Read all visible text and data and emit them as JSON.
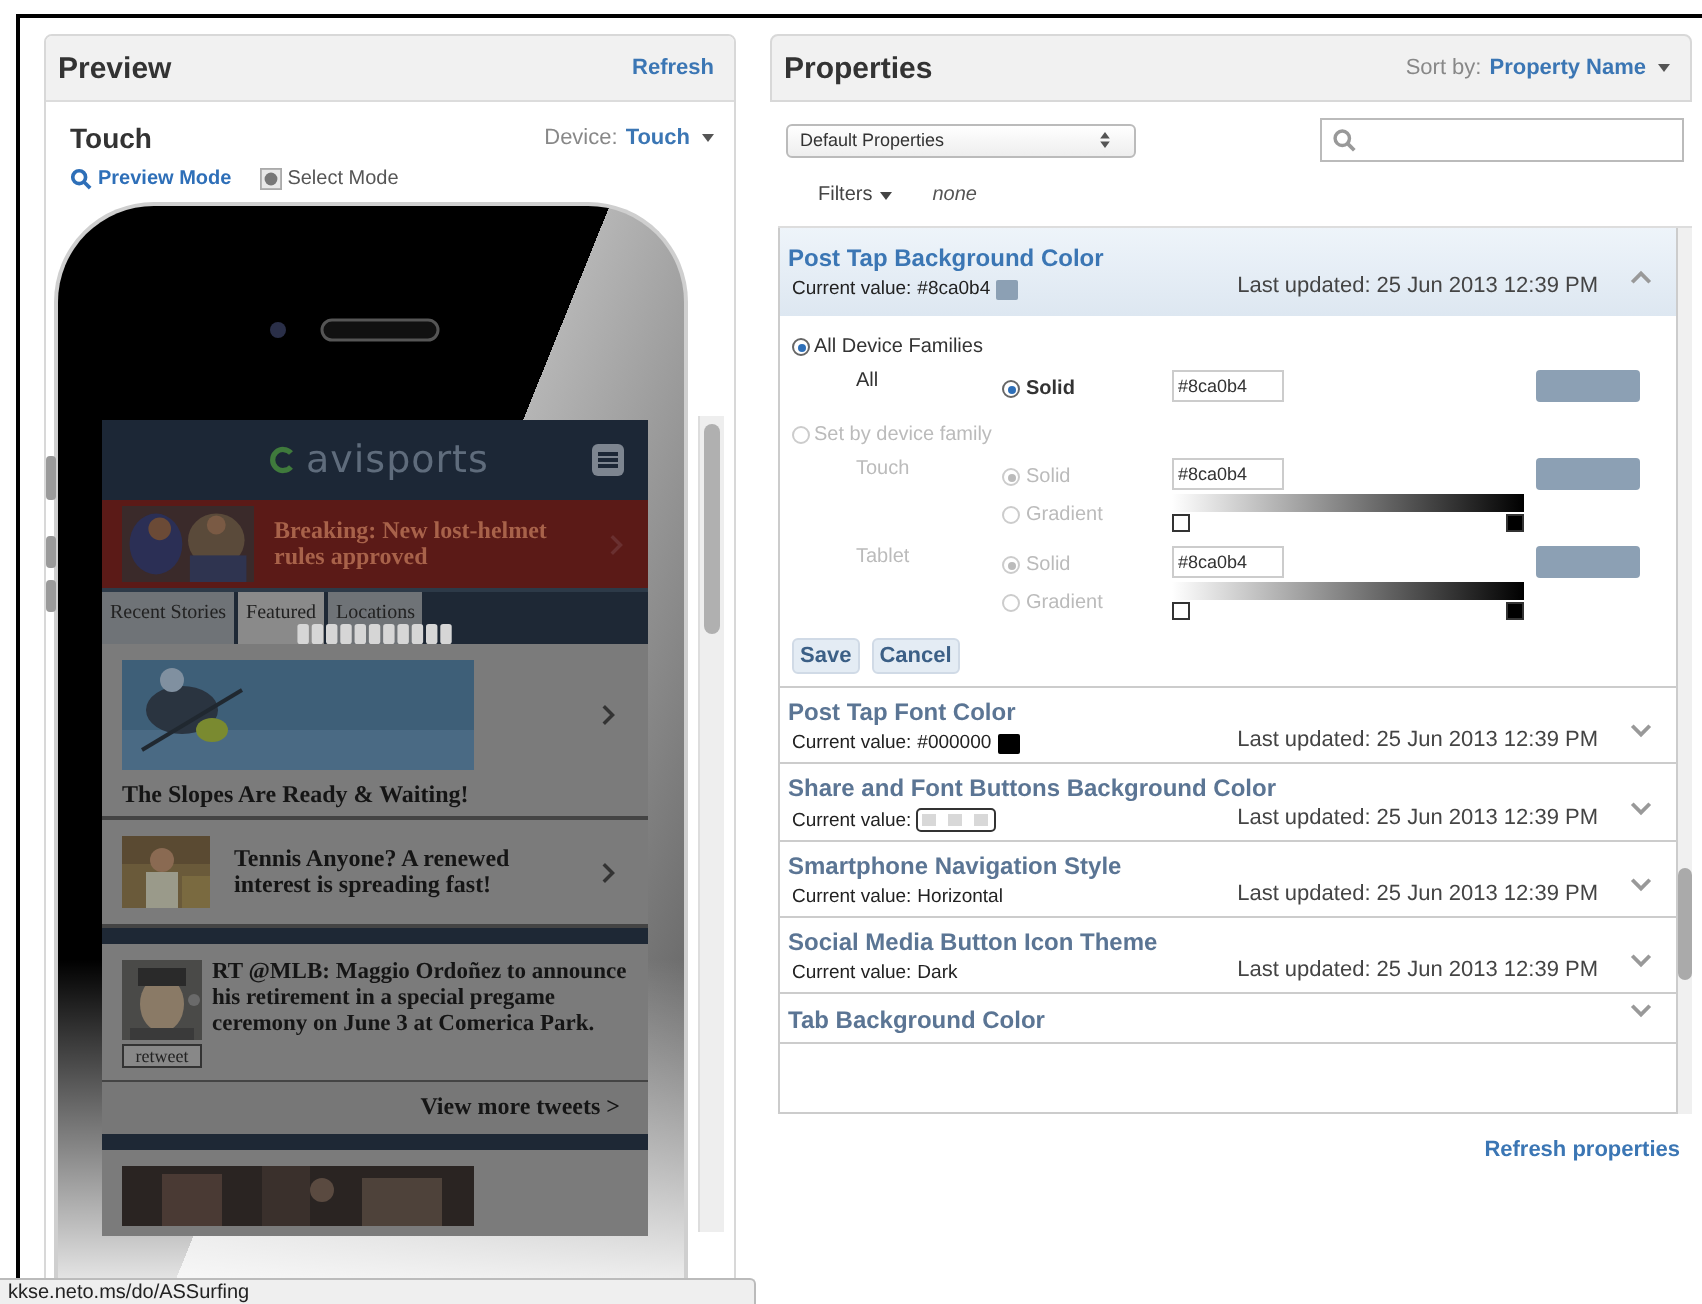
{
  "preview": {
    "title": "Preview",
    "refresh": "Refresh",
    "device_name": "Touch",
    "device_label": "Device:",
    "device_value": "Touch",
    "modes": [
      {
        "label": "Preview Mode",
        "selected": true
      },
      {
        "label": "Select Mode",
        "selected": false
      }
    ],
    "site": {
      "logo": "avisports",
      "breaking": "Breaking: New lost-helmet rules approved",
      "tabs": [
        {
          "label": "Recent Stories",
          "selected": false
        },
        {
          "label": "Featured",
          "selected": true
        },
        {
          "label": "Locations",
          "selected": false
        }
      ],
      "stories": [
        {
          "kind": "feature",
          "title": "The Slopes Are Ready & Waiting!"
        },
        {
          "kind": "thumb",
          "title": "Tennis Anyone? A renewed interest is spreading fast!"
        }
      ],
      "tweet": {
        "text": "RT @MLB: Maggio Ordoñez to announce his retirement in a special pregame ceremony on June 3 at Comerica Park.",
        "action": "retweet"
      },
      "more": "View more tweets >"
    }
  },
  "status_url": "kkse.neto.ms/do/ASSurfing",
  "properties": {
    "title": "Properties",
    "sort_label": "Sort by:",
    "sort_value": "Property Name",
    "preset": "Default Properties",
    "filters": "Filters",
    "filter_value": "none",
    "items": [
      {
        "name": "Post Tap Background Color",
        "value_label": "Current value:",
        "value": "#8ca0b4",
        "swatch": {
          "kind": "solid",
          "color": "#8ca0b4"
        },
        "updated": "Last updated: 25 Jun 2013 12:39 PM",
        "expanded": true,
        "editor": {
          "groups": [
            {
              "label": "All Device Families",
              "selected": true,
              "disabled": false,
              "rows": [
                {
                  "device": "All",
                  "fills": [
                    {
                      "label": "Solid",
                      "selected": true
                    }
                  ],
                  "hex": "#8ca0b4",
                  "color": "#8ca0b4",
                  "gradient": false
                }
              ]
            },
            {
              "label": "Set by device family",
              "selected": false,
              "disabled": true,
              "rows": [
                {
                  "device": "Touch",
                  "fills": [
                    {
                      "label": "Solid",
                      "selected": true
                    },
                    {
                      "label": "Gradient",
                      "selected": false
                    }
                  ],
                  "hex": "#8ca0b4",
                  "color": "#8ca0b4",
                  "gradient": true
                },
                {
                  "device": "Tablet",
                  "fills": [
                    {
                      "label": "Solid",
                      "selected": true
                    },
                    {
                      "label": "Gradient",
                      "selected": false
                    }
                  ],
                  "hex": "#8ca0b4",
                  "color": "#8ca0b4",
                  "gradient": true
                }
              ]
            }
          ],
          "buttons": [
            "Save",
            "Cancel"
          ]
        }
      },
      {
        "name": "Post Tap Font Color",
        "value_label": "Current value:",
        "value": "#000000",
        "swatch": {
          "kind": "solid",
          "color": "#000000"
        },
        "updated": "Last updated: 25 Jun 2013 12:39 PM",
        "expanded": false
      },
      {
        "name": "Share and Font Buttons Background Color",
        "value_label": "Current value:",
        "swatch": {
          "kind": "pattern",
          "color": "#d8d8d8"
        },
        "updated": "Last updated: 25 Jun 2013 12:39 PM",
        "expanded": false
      },
      {
        "name": "Smartphone Navigation Style",
        "value_label": "Current value:",
        "value": "Horizontal",
        "updated": "Last updated: 25 Jun 2013 12:39 PM",
        "expanded": false
      },
      {
        "name": "Social Media Button Icon Theme",
        "value_label": "Current value:",
        "value": "Dark",
        "updated": "Last updated: 25 Jun 2013 12:39 PM",
        "expanded": false
      },
      {
        "name": "Tab Background Color",
        "expanded": false
      }
    ],
    "refresh": "Refresh properties"
  }
}
